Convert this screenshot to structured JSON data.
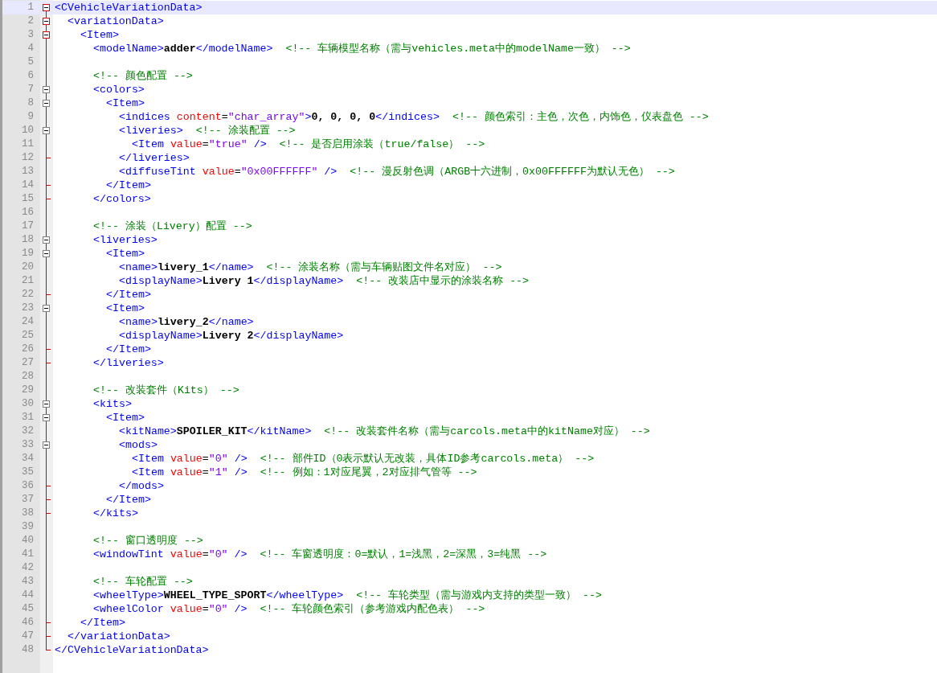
{
  "editor": {
    "lines": [
      {
        "number": "1",
        "selected": true,
        "kind": "open",
        "tokens": [
          {
            "kind": "tag",
            "text": "<CVehicleVariationData>"
          }
        ],
        "children": [
          {
            "number": "2",
            "selected": false,
            "kind": "open",
            "tokens": [
              {
                "kind": "tag",
                "text": "<variationData>"
              }
            ],
            "children": [
              {
                "number": "3",
                "selected": false,
                "kind": "open",
                "tokens": [
                  {
                    "kind": "tag",
                    "text": "<Item>"
                  }
                ],
                "children": [
                  {
                    "number": "4",
                    "selected": false,
                    "kind": "plain",
                    "tokens": [
                      {
                        "kind": "tag",
                        "text": "<modelName>"
                      },
                      {
                        "kind": "text",
                        "text": "adder"
                      },
                      {
                        "kind": "tag",
                        "text": "</modelName>"
                      },
                      {
                        "kind": "comment",
                        "text": "  <!-- 车辆模型名称（需与vehicles.meta中的modelName一致） -->"
                      }
                    ]
                  },
                  {
                    "number": "5",
                    "selected": false,
                    "kind": "plain"
                  },
                  {
                    "number": "6",
                    "selected": false,
                    "kind": "plain",
                    "tokens": [
                      {
                        "kind": "comment",
                        "text": "<!-- 颜色配置 -->"
                      }
                    ]
                  },
                  {
                    "number": "7",
                    "selected": false,
                    "kind": "open",
                    "tokens": [
                      {
                        "kind": "tag",
                        "text": "<colors>"
                      }
                    ],
                    "children": [
                      {
                        "number": "8",
                        "selected": false,
                        "kind": "open",
                        "tokens": [
                          {
                            "kind": "tag",
                            "text": "<Item>"
                          }
                        ],
                        "children": [
                          {
                            "number": "9",
                            "selected": false,
                            "kind": "plain",
                            "tokens": [
                              {
                                "kind": "tag",
                                "text": "<indices "
                              },
                              {
                                "kind": "attr",
                                "text": "content"
                              },
                              {
                                "kind": "plain",
                                "text": "="
                              },
                              {
                                "kind": "value",
                                "text": "\"char_array\""
                              },
                              {
                                "kind": "tag",
                                "text": ">"
                              },
                              {
                                "kind": "text",
                                "text": "0, 0, 0, 0"
                              },
                              {
                                "kind": "tag",
                                "text": "</indices>"
                              },
                              {
                                "kind": "comment",
                                "text": "  <!-- 颜色索引：主色，次色，内饰色，仪表盘色 -->"
                              }
                            ]
                          },
                          {
                            "number": "10",
                            "selected": false,
                            "kind": "open",
                            "tokens": [
                              {
                                "kind": "tag",
                                "text": "<liveries>"
                              },
                              {
                                "kind": "comment",
                                "text": "  <!-- 涂装配置 -->"
                              }
                            ],
                            "children": [
                              {
                                "number": "11",
                                "selected": false,
                                "kind": "plain",
                                "tokens": [
                                  {
                                    "kind": "tag",
                                    "text": "<Item "
                                  },
                                  {
                                    "kind": "attr",
                                    "text": "value"
                                  },
                                  {
                                    "kind": "plain",
                                    "text": "="
                                  },
                                  {
                                    "kind": "value",
                                    "text": "\"true\""
                                  },
                                  {
                                    "kind": "tag",
                                    "text": " />"
                                  },
                                  {
                                    "kind": "comment",
                                    "text": "  <!-- 是否启用涂装（true/false） -->"
                                  }
                                ]
                              }
                            ]
                          },
                          {
                            "number": "12",
                            "selected": false,
                            "kind": "close",
                            "tokens": [
                              {
                                "kind": "tag",
                                "text": "</liveries>"
                              }
                            ]
                          },
                          {
                            "number": "13",
                            "selected": false,
                            "kind": "plain",
                            "tokens": [
                              {
                                "kind": "tag",
                                "text": "<diffuseTint "
                              },
                              {
                                "kind": "attr",
                                "text": "value"
                              },
                              {
                                "kind": "plain",
                                "text": "="
                              },
                              {
                                "kind": "value",
                                "text": "\"0x00FFFFFF\""
                              },
                              {
                                "kind": "tag",
                                "text": " />"
                              },
                              {
                                "kind": "comment",
                                "text": "  <!-- 漫反射色调（ARGB十六进制，0x00FFFFFF为默认无色） -->"
                              }
                            ]
                          }
                        ]
                      },
                      {
                        "number": "14",
                        "selected": false,
                        "kind": "close",
                        "tokens": [
                          {
                            "kind": "tag",
                            "text": "</Item>"
                          }
                        ]
                      }
                    ]
                  },
                  {
                    "number": "15",
                    "selected": false,
                    "kind": "close",
                    "tokens": [
                      {
                        "kind": "tag",
                        "text": "</colors>"
                      }
                    ]
                  },
                  {
                    "number": "16",
                    "selected": false,
                    "kind": "plain"
                  },
                  {
                    "number": "17",
                    "selected": false,
                    "kind": "plain",
                    "tokens": [
                      {
                        "kind": "comment",
                        "text": "<!-- 涂装（Livery）配置 -->"
                      }
                    ]
                  },
                  {
                    "number": "18",
                    "selected": false,
                    "kind": "open",
                    "tokens": [
                      {
                        "kind": "tag",
                        "text": "<liveries>"
                      }
                    ],
                    "children": [
                      {
                        "number": "19",
                        "selected": false,
                        "kind": "open",
                        "tokens": [
                          {
                            "kind": "tag",
                            "text": "<Item>"
                          }
                        ],
                        "children": [
                          {
                            "number": "20",
                            "selected": false,
                            "kind": "plain",
                            "tokens": [
                              {
                                "kind": "tag",
                                "text": "<name>"
                              },
                              {
                                "kind": "text",
                                "text": "livery_1"
                              },
                              {
                                "kind": "tag",
                                "text": "</name>"
                              },
                              {
                                "kind": "comment",
                                "text": "  <!-- 涂装名称（需与车辆贴图文件名对应） -->"
                              }
                            ]
                          },
                          {
                            "number": "21",
                            "selected": false,
                            "kind": "plain",
                            "tokens": [
                              {
                                "kind": "tag",
                                "text": "<displayName>"
                              },
                              {
                                "kind": "text",
                                "text": "Livery 1"
                              },
                              {
                                "kind": "tag",
                                "text": "</displayName>"
                              },
                              {
                                "kind": "comment",
                                "text": "  <!-- 改装店中显示的涂装名称 -->"
                              }
                            ]
                          }
                        ]
                      },
                      {
                        "number": "22",
                        "selected": false,
                        "kind": "close",
                        "tokens": [
                          {
                            "kind": "tag",
                            "text": "</Item>"
                          }
                        ]
                      },
                      {
                        "number": "23",
                        "selected": false,
                        "kind": "open",
                        "tokens": [
                          {
                            "kind": "tag",
                            "text": "<Item>"
                          }
                        ],
                        "children": [
                          {
                            "number": "24",
                            "selected": false,
                            "kind": "plain",
                            "tokens": [
                              {
                                "kind": "tag",
                                "text": "<name>"
                              },
                              {
                                "kind": "text",
                                "text": "livery_2"
                              },
                              {
                                "kind": "tag",
                                "text": "</name>"
                              }
                            ]
                          },
                          {
                            "number": "25",
                            "selected": false,
                            "kind": "plain",
                            "tokens": [
                              {
                                "kind": "tag",
                                "text": "<displayName>"
                              },
                              {
                                "kind": "text",
                                "text": "Livery 2"
                              },
                              {
                                "kind": "tag",
                                "text": "</displayName>"
                              }
                            ]
                          }
                        ]
                      },
                      {
                        "number": "26",
                        "selected": false,
                        "kind": "close",
                        "tokens": [
                          {
                            "kind": "tag",
                            "text": "</Item>"
                          }
                        ]
                      }
                    ]
                  },
                  {
                    "number": "27",
                    "selected": false,
                    "kind": "close",
                    "tokens": [
                      {
                        "kind": "tag",
                        "text": "</liveries>"
                      }
                    ]
                  },
                  {
                    "number": "28",
                    "selected": false,
                    "kind": "plain"
                  },
                  {
                    "number": "29",
                    "selected": false,
                    "kind": "plain",
                    "tokens": [
                      {
                        "kind": "comment",
                        "text": "<!-- 改装套件（Kits） -->"
                      }
                    ]
                  },
                  {
                    "number": "30",
                    "selected": false,
                    "kind": "open",
                    "tokens": [
                      {
                        "kind": "tag",
                        "text": "<kits>"
                      }
                    ],
                    "children": [
                      {
                        "number": "31",
                        "selected": false,
                        "kind": "open",
                        "tokens": [
                          {
                            "kind": "tag",
                            "text": "<Item>"
                          }
                        ],
                        "children": [
                          {
                            "number": "32",
                            "selected": false,
                            "kind": "plain",
                            "tokens": [
                              {
                                "kind": "tag",
                                "text": "<kitName>"
                              },
                              {
                                "kind": "text",
                                "text": "SPOILER_KIT"
                              },
                              {
                                "kind": "tag",
                                "text": "</kitName>"
                              },
                              {
                                "kind": "comment",
                                "text": "  <!-- 改装套件名称（需与carcols.meta中的kitName对应） -->"
                              }
                            ]
                          },
                          {
                            "number": "33",
                            "selected": false,
                            "kind": "open",
                            "tokens": [
                              {
                                "kind": "tag",
                                "text": "<mods>"
                              }
                            ],
                            "children": [
                              {
                                "number": "34",
                                "selected": false,
                                "kind": "plain",
                                "tokens": [
                                  {
                                    "kind": "tag",
                                    "text": "<Item "
                                  },
                                  {
                                    "kind": "attr",
                                    "text": "value"
                                  },
                                  {
                                    "kind": "plain",
                                    "text": "="
                                  },
                                  {
                                    "kind": "value",
                                    "text": "\"0\""
                                  },
                                  {
                                    "kind": "tag",
                                    "text": " />"
                                  },
                                  {
                                    "kind": "comment",
                                    "text": "  <!-- 部件ID（0表示默认无改装，具体ID参考carcols.meta） -->"
                                  }
                                ]
                              },
                              {
                                "number": "35",
                                "selected": false,
                                "kind": "plain",
                                "tokens": [
                                  {
                                    "kind": "tag",
                                    "text": "<Item "
                                  },
                                  {
                                    "kind": "attr",
                                    "text": "value"
                                  },
                                  {
                                    "kind": "plain",
                                    "text": "="
                                  },
                                  {
                                    "kind": "value",
                                    "text": "\"1\""
                                  },
                                  {
                                    "kind": "tag",
                                    "text": " />"
                                  },
                                  {
                                    "kind": "comment",
                                    "text": "  <!-- 例如：1对应尾翼，2对应排气管等 -->"
                                  }
                                ]
                              }
                            ]
                          },
                          {
                            "number": "36",
                            "selected": false,
                            "kind": "close",
                            "tokens": [
                              {
                                "kind": "tag",
                                "text": "</mods>"
                              }
                            ]
                          }
                        ]
                      },
                      {
                        "number": "37",
                        "selected": false,
                        "kind": "close",
                        "tokens": [
                          {
                            "kind": "tag",
                            "text": "</Item>"
                          }
                        ]
                      }
                    ]
                  },
                  {
                    "number": "38",
                    "selected": false,
                    "kind": "close",
                    "tokens": [
                      {
                        "kind": "tag",
                        "text": "</kits>"
                      }
                    ]
                  },
                  {
                    "number": "39",
                    "selected": false,
                    "kind": "plain"
                  },
                  {
                    "number": "40",
                    "selected": false,
                    "kind": "plain",
                    "tokens": [
                      {
                        "kind": "comment",
                        "text": "<!-- 窗口透明度 -->"
                      }
                    ]
                  },
                  {
                    "number": "41",
                    "selected": false,
                    "kind": "plain",
                    "tokens": [
                      {
                        "kind": "tag",
                        "text": "<windowTint "
                      },
                      {
                        "kind": "attr",
                        "text": "value"
                      },
                      {
                        "kind": "plain",
                        "text": "="
                      },
                      {
                        "kind": "value",
                        "text": "\"0\""
                      },
                      {
                        "kind": "tag",
                        "text": " />"
                      },
                      {
                        "kind": "comment",
                        "text": "  <!-- 车窗透明度：0=默认，1=浅黑，2=深黑，3=纯黑 -->"
                      }
                    ]
                  },
                  {
                    "number": "42",
                    "selected": false,
                    "kind": "plain"
                  },
                  {
                    "number": "43",
                    "selected": false,
                    "kind": "plain",
                    "tokens": [
                      {
                        "kind": "comment",
                        "text": "<!-- 车轮配置 -->"
                      }
                    ]
                  },
                  {
                    "number": "44",
                    "selected": false,
                    "kind": "plain",
                    "tokens": [
                      {
                        "kind": "tag",
                        "text": "<wheelType>"
                      },
                      {
                        "kind": "text",
                        "text": "WHEEL_TYPE_SPORT"
                      },
                      {
                        "kind": "tag",
                        "text": "</wheelType>"
                      },
                      {
                        "kind": "comment",
                        "text": "  <!-- 车轮类型（需与游戏内支持的类型一致） -->"
                      }
                    ]
                  },
                  {
                    "number": "45",
                    "selected": false,
                    "kind": "plain",
                    "tokens": [
                      {
                        "kind": "tag",
                        "text": "<wheelColor "
                      },
                      {
                        "kind": "attr",
                        "text": "value"
                      },
                      {
                        "kind": "plain",
                        "text": "="
                      },
                      {
                        "kind": "value",
                        "text": "\"0\""
                      },
                      {
                        "kind": "tag",
                        "text": " />"
                      },
                      {
                        "kind": "comment",
                        "text": "  <!-- 车轮颜色索引（参考游戏内配色表） -->"
                      }
                    ]
                  }
                ]
              },
              {
                "number": "46",
                "selected": false,
                "kind": "close",
                "tokens": [
                  {
                    "kind": "tag",
                    "text": "</Item>"
                  }
                ]
              }
            ]
          },
          {
            "number": "47",
            "selected": false,
            "kind": "close",
            "tokens": [
              {
                "kind": "tag",
                "text": "</variationData>"
              }
            ]
          }
        ]
      },
      {
        "number": "48",
        "selected": false,
        "kind": "end",
        "tokens": [
          {
            "kind": "tag",
            "text": "</CVehicleVariationData>"
          }
        ]
      }
    ]
  }
}
